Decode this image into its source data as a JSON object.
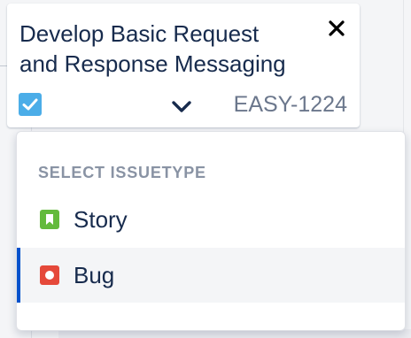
{
  "card": {
    "title": "Develop Basic Request\nand Response Messaging",
    "issue_key": "EASY-1224",
    "issuetype_icon": "checkbox-task-icon",
    "close_icon": "close-icon",
    "expand_icon": "chevron-down-icon"
  },
  "dropdown": {
    "heading": "SELECT ISSUETYPE",
    "options": [
      {
        "label": "Story",
        "icon": "story-icon",
        "color": "#63ba3c"
      },
      {
        "label": "Bug",
        "icon": "bug-icon",
        "color": "#e5493a",
        "selected": true
      }
    ]
  },
  "colors": {
    "task_blue": "#4bade8",
    "selected_accent": "#0052cc",
    "muted_text": "#6b778c"
  }
}
